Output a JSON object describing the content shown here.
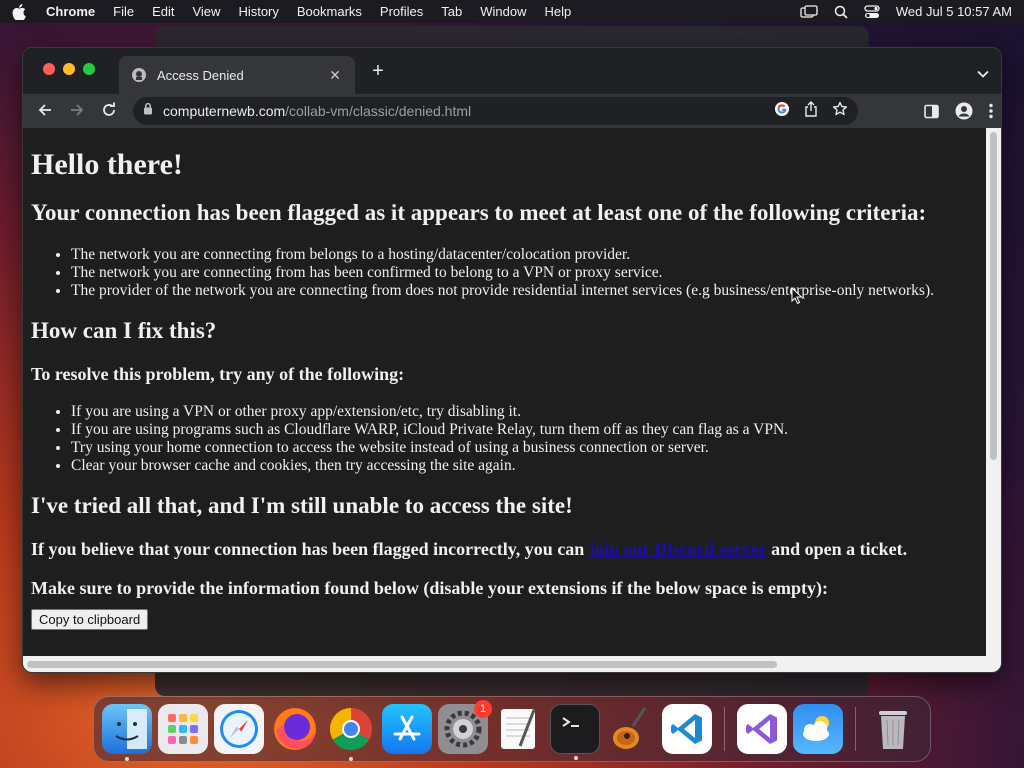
{
  "menubar": {
    "app": "Chrome",
    "items": [
      "File",
      "Edit",
      "View",
      "History",
      "Bookmarks",
      "Profiles",
      "Tab",
      "Window",
      "Help"
    ],
    "clock": "Wed Jul 5  10:57 AM"
  },
  "browser": {
    "tab_title": "Access Denied",
    "url_domain": "computernewb.com",
    "url_path": "/collab-vm/classic/denied.html"
  },
  "page": {
    "heading": "Hello there!",
    "flagged_heading": "Your connection has been flagged as it appears to meet at least one of the following criteria:",
    "criteria": [
      "The network you are connecting from belongs to a hosting/datacenter/colocation provider.",
      "The network you are connecting from has been confirmed to belong to a VPN or proxy service.",
      "The provider of the network you are connecting from does not provide residential internet services (e.g business/enterprise-only networks)."
    ],
    "fix_heading": "How can I fix this?",
    "resolve_heading": "To resolve this problem, try any of the following:",
    "fixes": [
      "If you are using a VPN or other proxy app/extension/etc, try disabling it.",
      "If you are using programs such as Cloudflare WARP, iCloud Private Relay, turn them off as they can flag as a VPN.",
      "Try using your home connection to access the website instead of using a business connection or server.",
      "Clear your browser cache and cookies, then try accessing the site again."
    ],
    "tried_heading": "I've tried all that, and I'm still unable to access the site!",
    "incorrect_prefix": "If you believe that your connection has been flagged incorrectly, you can ",
    "discord_link": "join our Discord server",
    "incorrect_suffix": " and open a ticket.",
    "info_heading": "Make sure to provide the information found below (disable your extensions if the below space is empty):",
    "copy_button": "Copy to clipboard"
  },
  "dock": {
    "apps": [
      "finder-icon",
      "launchpad-icon",
      "safari-icon",
      "firefox-icon",
      "chrome-icon",
      "app-store-icon",
      "system-settings-icon",
      "textedit-icon",
      "terminal-icon",
      "garageband-icon",
      "vscode-icon",
      "visual-studio-icon",
      "weather-icon",
      "trash-icon"
    ],
    "settings_badge": "1"
  }
}
